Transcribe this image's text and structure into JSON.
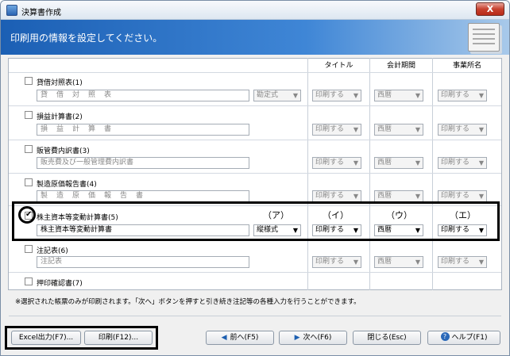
{
  "window": {
    "title": "決算書作成",
    "close_label": "X"
  },
  "header": {
    "title": "印刷用の情報を設定してください。"
  },
  "columns": {
    "title": "タイトル",
    "period": "会計期間",
    "company": "事業所名"
  },
  "rows": [
    {
      "label": "貸借対照表(1)",
      "text": "貸　借　対　照　表",
      "format": "勘定式",
      "title": "印刷する",
      "period": "西暦",
      "company": "印刷する",
      "checked": false
    },
    {
      "label": "損益計算書(2)",
      "text": "損　益　計　算　書",
      "title": "印刷する",
      "period": "西暦",
      "company": "印刷する",
      "checked": false
    },
    {
      "label": "販管費内訳書(3)",
      "text": "販売費及び一般管理費内訳書",
      "title": "印刷する",
      "period": "西暦",
      "company": "印刷する",
      "checked": false
    },
    {
      "label": "製造原価報告書(4)",
      "text": "製　造　原　価　報　告　書",
      "title": "印刷する",
      "period": "西暦",
      "company": "印刷する",
      "checked": false
    },
    {
      "label": "株主資本等変動計算書(5)",
      "text": "株主資本等変動計算書",
      "format": "縦様式",
      "title": "印刷する",
      "period": "西暦",
      "company": "印刷する",
      "checked": true
    },
    {
      "label": "注記表(6)",
      "text": "注記表",
      "title": "印刷する",
      "period": "西暦",
      "company": "印刷する",
      "checked": false
    },
    {
      "label": "押印確認書(7)",
      "checked": false
    }
  ],
  "markers": {
    "a": "（ア）",
    "i": "（イ）",
    "u": "（ウ）",
    "e": "（エ）"
  },
  "note": "※選択された帳票のみが印刷されます。「次へ」ボタンを押すと引き続き注記等の各種入力を行うことができます。",
  "buttons": {
    "excel": "Excel出力(F7)...",
    "print": "印刷(F12)...",
    "prev": "前へ(F5)",
    "next": "次へ(F6)",
    "close": "閉じる(Esc)",
    "help": "ヘルプ(F1)",
    "help_glyph": "?"
  }
}
